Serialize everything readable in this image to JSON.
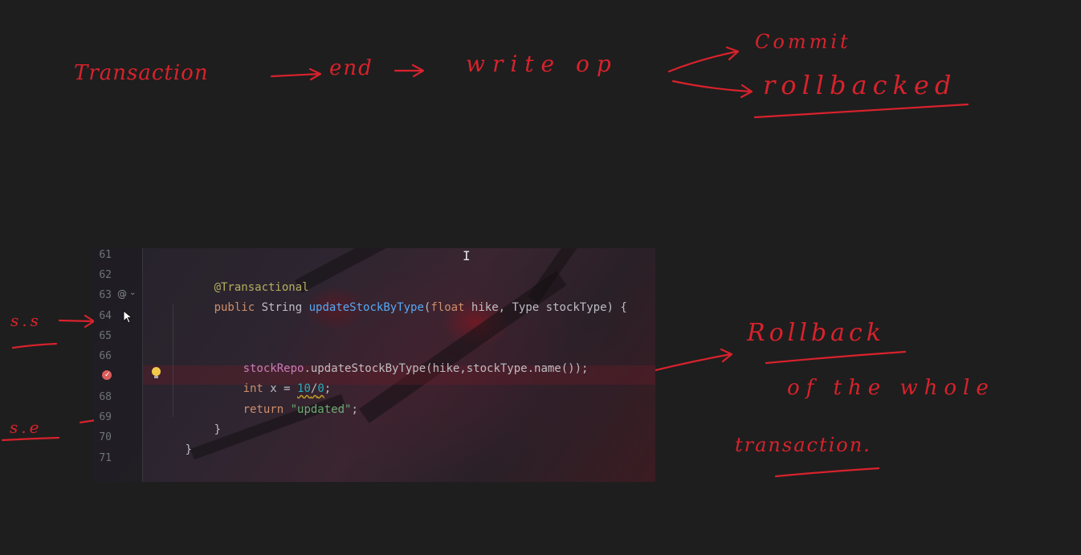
{
  "annotations": {
    "top": {
      "transaction": "Transaction",
      "end": "end",
      "write_op": "write op",
      "commit": "Commit",
      "rollbacked": "rollbacked"
    },
    "left": {
      "ss": "s.s",
      "se": "s.e"
    },
    "right": {
      "rollback": "Rollback",
      "of_the_whole": "of the whole",
      "transaction": "transaction."
    },
    "ink_color": "#d8222c"
  },
  "editor": {
    "line_numbers": [
      "61",
      "62",
      "63",
      "64",
      "65",
      "66",
      "67",
      "68",
      "69",
      "70",
      "71"
    ],
    "breakpoint_line": "67",
    "icons": [
      "override-at-icon",
      "fold-chevron-icon",
      "breakpoint-icon",
      "lightbulb-icon",
      "text-cursor-icon",
      "mouse-pointer-icon"
    ],
    "code": {
      "l62_annotation": "@Transactional",
      "l63_public": "public ",
      "l63_type": "String ",
      "l63_method": "updateStockByType",
      "l63_open": "(",
      "l63_float": "float ",
      "l63_params": "hike, Type stockType) {",
      "l66_field": "stockRepo",
      "l66_rest": ".updateStockByType(hike,stockType.name());",
      "l67_int": "int ",
      "l67_x": "x = ",
      "l67_ten": "10",
      "l67_slash": "/",
      "l67_zero": "0",
      "l67_end": ";",
      "l68_return": "return ",
      "l68_str": "\"updated\"",
      "l68_end": ";",
      "l69_close": "}",
      "l70_close": "}"
    },
    "colors": {
      "annotation": "#b3ae60",
      "keyword": "#cf8e6d",
      "method": "#56a8f5",
      "field": "#c77dbb",
      "number": "#2aacb8",
      "string": "#6aab73"
    }
  }
}
